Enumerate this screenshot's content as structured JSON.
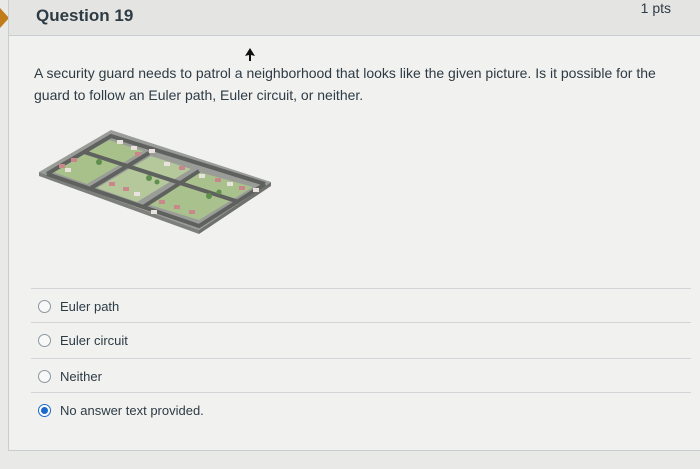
{
  "question": {
    "title": "Question 19",
    "points": "1 pts",
    "text": "A security guard needs to patrol a neighborhood that looks like the given picture.  Is it possible for the guard to follow an Euler path, Euler circuit, or neither."
  },
  "answers": [
    {
      "label": "Euler path",
      "selected": false
    },
    {
      "label": "Euler circuit",
      "selected": false
    },
    {
      "label": "Neither",
      "selected": false
    },
    {
      "label": "No answer text provided.",
      "selected": true
    }
  ],
  "colors": {
    "accent": "#c17b1a",
    "selected_radio": "#1b6ac9",
    "text": "#2d3b45"
  }
}
